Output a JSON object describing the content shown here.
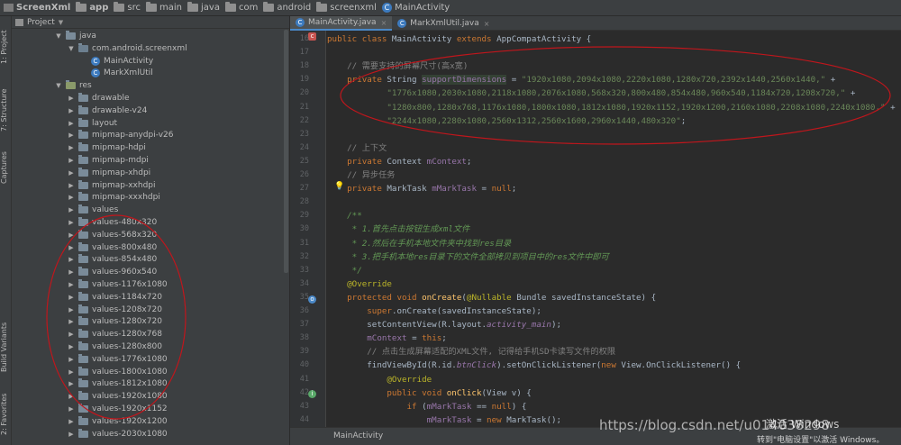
{
  "breadcrumb": [
    "ScreenXml",
    "app",
    "src",
    "main",
    "java",
    "com",
    "android",
    "screenxml",
    "MainActivity"
  ],
  "tool_windows": {
    "project": "1: Project",
    "structure": "7: Structure",
    "captures": "Captures",
    "build_variants": "Build Variants",
    "favorites": "2: Favorites"
  },
  "project_panel": {
    "title": "Project",
    "tree": [
      {
        "label": "java",
        "kind": "folder",
        "indent": 1,
        "expanded": true
      },
      {
        "label": "com.android.screenxml",
        "kind": "package",
        "indent": 2,
        "expanded": true
      },
      {
        "label": "MainActivity",
        "kind": "class",
        "indent": 3
      },
      {
        "label": "MarkXmlUtil",
        "kind": "class",
        "indent": 3
      },
      {
        "label": "res",
        "kind": "res",
        "indent": 1,
        "expanded": true
      },
      {
        "label": "drawable",
        "kind": "folder",
        "indent": 2
      },
      {
        "label": "drawable-v24",
        "kind": "folder",
        "indent": 2
      },
      {
        "label": "layout",
        "kind": "folder",
        "indent": 2
      },
      {
        "label": "mipmap-anydpi-v26",
        "kind": "folder",
        "indent": 2
      },
      {
        "label": "mipmap-hdpi",
        "kind": "folder",
        "indent": 2
      },
      {
        "label": "mipmap-mdpi",
        "kind": "folder",
        "indent": 2
      },
      {
        "label": "mipmap-xhdpi",
        "kind": "folder",
        "indent": 2
      },
      {
        "label": "mipmap-xxhdpi",
        "kind": "folder",
        "indent": 2
      },
      {
        "label": "mipmap-xxxhdpi",
        "kind": "folder",
        "indent": 2
      },
      {
        "label": "values",
        "kind": "folder",
        "indent": 2
      },
      {
        "label": "values-480x320",
        "kind": "folder",
        "indent": 2
      },
      {
        "label": "values-568x320",
        "kind": "folder",
        "indent": 2
      },
      {
        "label": "values-800x480",
        "kind": "folder",
        "indent": 2
      },
      {
        "label": "values-854x480",
        "kind": "folder",
        "indent": 2
      },
      {
        "label": "values-960x540",
        "kind": "folder",
        "indent": 2
      },
      {
        "label": "values-1176x1080",
        "kind": "folder",
        "indent": 2
      },
      {
        "label": "values-1184x720",
        "kind": "folder",
        "indent": 2
      },
      {
        "label": "values-1208x720",
        "kind": "folder",
        "indent": 2
      },
      {
        "label": "values-1280x720",
        "kind": "folder",
        "indent": 2
      },
      {
        "label": "values-1280x768",
        "kind": "folder",
        "indent": 2
      },
      {
        "label": "values-1280x800",
        "kind": "folder",
        "indent": 2
      },
      {
        "label": "values-1776x1080",
        "kind": "folder",
        "indent": 2
      },
      {
        "label": "values-1800x1080",
        "kind": "folder",
        "indent": 2
      },
      {
        "label": "values-1812x1080",
        "kind": "folder",
        "indent": 2
      },
      {
        "label": "values-1920x1080",
        "kind": "folder",
        "indent": 2
      },
      {
        "label": "values-1920x1152",
        "kind": "folder",
        "indent": 2
      },
      {
        "label": "values-1920x1200",
        "kind": "folder",
        "indent": 2
      },
      {
        "label": "values-2030x1080",
        "kind": "folder",
        "indent": 2
      }
    ]
  },
  "editor": {
    "tabs": [
      {
        "label": "MainActivity.java",
        "active": true
      },
      {
        "label": "MarkXmlUtil.java",
        "active": false
      }
    ],
    "line_numbers": [
      "16",
      "17",
      "18",
      "19",
      "20",
      "21",
      "22",
      "23",
      "24",
      "25",
      "26",
      "27",
      "28",
      "29",
      "30",
      "31",
      "32",
      "33",
      "34",
      "35",
      "36",
      "37",
      "38",
      "39",
      "40",
      "41",
      "42",
      "43",
      "44"
    ],
    "lines": [
      [
        {
          "t": "public class ",
          "c": "kw"
        },
        {
          "t": "MainActivity "
        },
        {
          "t": "extends ",
          "c": "kw"
        },
        {
          "t": "AppCompatActivity {"
        }
      ],
      [],
      [
        {
          "t": "    // 需要支持的屏幕尺寸(高x宽)",
          "c": "cm"
        }
      ],
      [
        {
          "t": "    private ",
          "c": "kw"
        },
        {
          "t": "String "
        },
        {
          "t": "supportDimensions",
          "c": "fld hl"
        },
        {
          "t": " = "
        },
        {
          "t": "\"1920x1080,2094x1080,2220x1080,1280x720,2392x1440,2560x1440,\"",
          "c": "str"
        },
        {
          "t": " +"
        }
      ],
      [
        {
          "t": "            "
        },
        {
          "t": "\"1776x1080,2030x1080,2118x1080,2076x1080,568x320,800x480,854x480,960x540,1184x720,1208x720,\"",
          "c": "str"
        },
        {
          "t": " +"
        }
      ],
      [
        {
          "t": "            "
        },
        {
          "t": "\"1280x800,1280x768,1176x1080,1800x1080,1812x1080,1920x1152,1920x1200,2160x1080,2208x1080,2240x1080,\"",
          "c": "str"
        },
        {
          "t": " +"
        }
      ],
      [
        {
          "t": "            "
        },
        {
          "t": "\"2244x1080,2280x1080,2560x1312,2560x1600,2960x1440,480x320\"",
          "c": "str"
        },
        {
          "t": ";"
        }
      ],
      [],
      [
        {
          "t": "    // 上下文",
          "c": "cm"
        }
      ],
      [
        {
          "t": "    private ",
          "c": "kw"
        },
        {
          "t": "Context "
        },
        {
          "t": "mContext",
          "c": "fld"
        },
        {
          "t": ";"
        }
      ],
      [
        {
          "t": "    // 异步任务",
          "c": "cm"
        }
      ],
      [
        {
          "t": "    private ",
          "c": "kw"
        },
        {
          "t": "MarkTask "
        },
        {
          "t": "mMarkTask",
          "c": "fld"
        },
        {
          "t": " = "
        },
        {
          "t": "null",
          "c": "kw"
        },
        {
          "t": ";"
        }
      ],
      [],
      [
        {
          "t": "    /**",
          "c": "jd"
        }
      ],
      [
        {
          "t": "     * 1.首先点击按钮生成xml文件",
          "c": "jd"
        }
      ],
      [
        {
          "t": "     * 2.然后在手机本地文件夹中找到res目录",
          "c": "jd"
        }
      ],
      [
        {
          "t": "     * 3.把手机本地res目录下的文件全部拷贝到项目中的res文件中即可",
          "c": "jd"
        }
      ],
      [
        {
          "t": "     */",
          "c": "jd"
        }
      ],
      [
        {
          "t": "    @Override",
          "c": "ann"
        }
      ],
      [
        {
          "t": "    protected void ",
          "c": "kw"
        },
        {
          "t": "onCreate",
          "c": "fn"
        },
        {
          "t": "("
        },
        {
          "t": "@Nullable ",
          "c": "ann"
        },
        {
          "t": "Bundle savedInstanceState) {"
        }
      ],
      [
        {
          "t": "        "
        },
        {
          "t": "super",
          "c": "kw"
        },
        {
          "t": ".onCreate(savedInstanceState);"
        }
      ],
      [
        {
          "t": "        setContentView(R.layout."
        },
        {
          "t": "activity_main",
          "c": "fld it"
        },
        {
          "t": ");"
        }
      ],
      [
        {
          "t": "        "
        },
        {
          "t": "mContext",
          "c": "fld"
        },
        {
          "t": " = "
        },
        {
          "t": "this",
          "c": "kw"
        },
        {
          "t": ";"
        }
      ],
      [
        {
          "t": "        // 点击生成屏幕适配的XML文件, 记得给手机SD卡读写文件的权限",
          "c": "cm"
        }
      ],
      [
        {
          "t": "        findViewById(R.id."
        },
        {
          "t": "btnClick",
          "c": "fld it"
        },
        {
          "t": ").setOnClickListener("
        },
        {
          "t": "new ",
          "c": "kw"
        },
        {
          "t": "View.OnClickListener() {"
        }
      ],
      [
        {
          "t": "            @Override",
          "c": "ann"
        }
      ],
      [
        {
          "t": "            public void ",
          "c": "kw"
        },
        {
          "t": "onClick",
          "c": "fn"
        },
        {
          "t": "(View v) {"
        }
      ],
      [
        {
          "t": "                "
        },
        {
          "t": "if ",
          "c": "kw"
        },
        {
          "t": "("
        },
        {
          "t": "mMarkTask",
          "c": "fld"
        },
        {
          "t": " == "
        },
        {
          "t": "null",
          "c": "kw"
        },
        {
          "t": ") {"
        }
      ],
      [
        {
          "t": "                    "
        },
        {
          "t": "mMarkTask",
          "c": "fld"
        },
        {
          "t": " = "
        },
        {
          "t": "new ",
          "c": "kw"
        },
        {
          "t": "MarkTask();"
        }
      ]
    ]
  },
  "status_bar": {
    "context": "MainActivity"
  },
  "overlay": {
    "watermark": "https://blog.csdn.net/u014038298",
    "activate_title": "激活 Windows",
    "activate_hint": "转到\"电脑设置\"以激活 Windows。"
  },
  "colors": {
    "annotation_ellipse": "#c0161c"
  }
}
